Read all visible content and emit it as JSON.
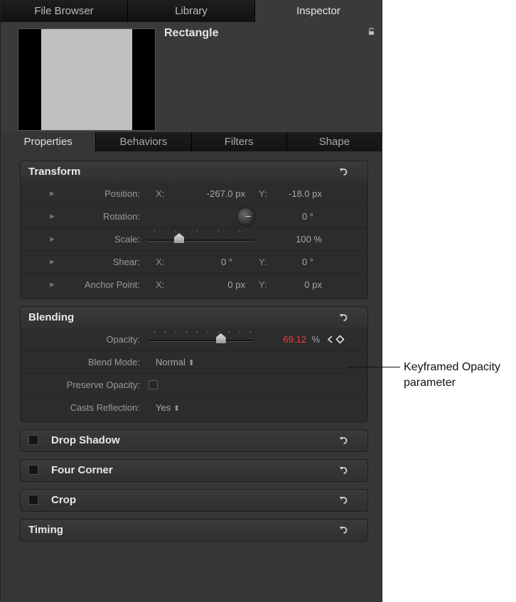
{
  "top_tabs": [
    "File Browser",
    "Library",
    "Inspector"
  ],
  "object_name": "Rectangle",
  "sub_tabs": [
    "Properties",
    "Behaviors",
    "Filters",
    "Shape"
  ],
  "transform": {
    "title": "Transform",
    "position": {
      "label": "Position:",
      "x_label": "X:",
      "x": "-267.0 px",
      "y_label": "Y:",
      "y": "-18.0 px"
    },
    "rotation": {
      "label": "Rotation:",
      "value": "0 °"
    },
    "scale": {
      "label": "Scale:",
      "value": "100 %",
      "level": 0.3
    },
    "shear": {
      "label": "Shear:",
      "x_label": "X:",
      "x": "0 °",
      "y_label": "Y:",
      "y": "0 °"
    },
    "anchor": {
      "label": "Anchor Point:",
      "x_label": "X:",
      "x": "0 px",
      "y_label": "Y:",
      "y": "0 px"
    }
  },
  "blending": {
    "title": "Blending",
    "opacity": {
      "label": "Opacity:",
      "value": "69.12",
      "unit": "%",
      "level": 0.6912
    },
    "blend_mode": {
      "label": "Blend Mode:",
      "value": "Normal"
    },
    "preserve_opacity": {
      "label": "Preserve Opacity:",
      "checked": false
    },
    "casts_reflection": {
      "label": "Casts Reflection:",
      "value": "Yes"
    }
  },
  "collapsed_sections": [
    {
      "title": "Drop Shadow"
    },
    {
      "title": "Four Corner"
    },
    {
      "title": "Crop"
    },
    {
      "title": "Timing"
    }
  ],
  "annotation": {
    "line1": "Keyframed Opacity",
    "line2": "parameter"
  },
  "colors": {
    "keyframed_value": "#e84040",
    "panel": "#363636"
  }
}
